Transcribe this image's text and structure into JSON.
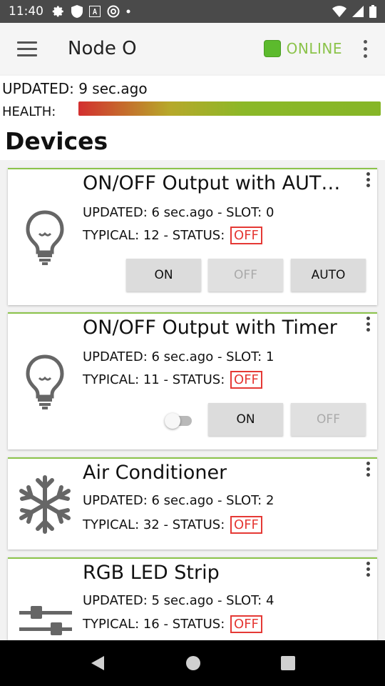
{
  "status_bar": {
    "time": "11:40"
  },
  "app_bar": {
    "title": "Node O",
    "status": "ONLINE",
    "status_color": "#5cba2d"
  },
  "summary": {
    "updated": "UPDATED: 9 sec.ago",
    "health_label": "HEALTH:",
    "section_title": "Devices"
  },
  "devices": [
    {
      "name": "ON/OFF Output with AUT…",
      "line1": "UPDATED: 6 sec.ago - SLOT: 0",
      "typical": "TYPICAL: 12 - STATUS:",
      "status": "OFF",
      "icon": "lightbulb-icon",
      "buttons": [
        "ON",
        "OFF",
        "AUTO"
      ]
    },
    {
      "name": "ON/OFF Output with Timer",
      "line1": "UPDATED: 6 sec.ago - SLOT: 1",
      "typical": "TYPICAL: 11 - STATUS:",
      "status": "OFF",
      "icon": "lightbulb-icon",
      "buttons": [
        "ON",
        "OFF"
      ]
    },
    {
      "name": "Air Conditioner",
      "line1": "UPDATED: 6 sec.ago - SLOT: 2",
      "typical": "TYPICAL: 32 - STATUS:",
      "status": "OFF",
      "icon": "snowflake-icon"
    },
    {
      "name": "RGB LED Strip",
      "line1": "UPDATED: 5 sec.ago - SLOT: 4",
      "typical": "TYPICAL: 16 - STATUS:",
      "status": "OFF",
      "icon": "sliders-icon"
    }
  ]
}
